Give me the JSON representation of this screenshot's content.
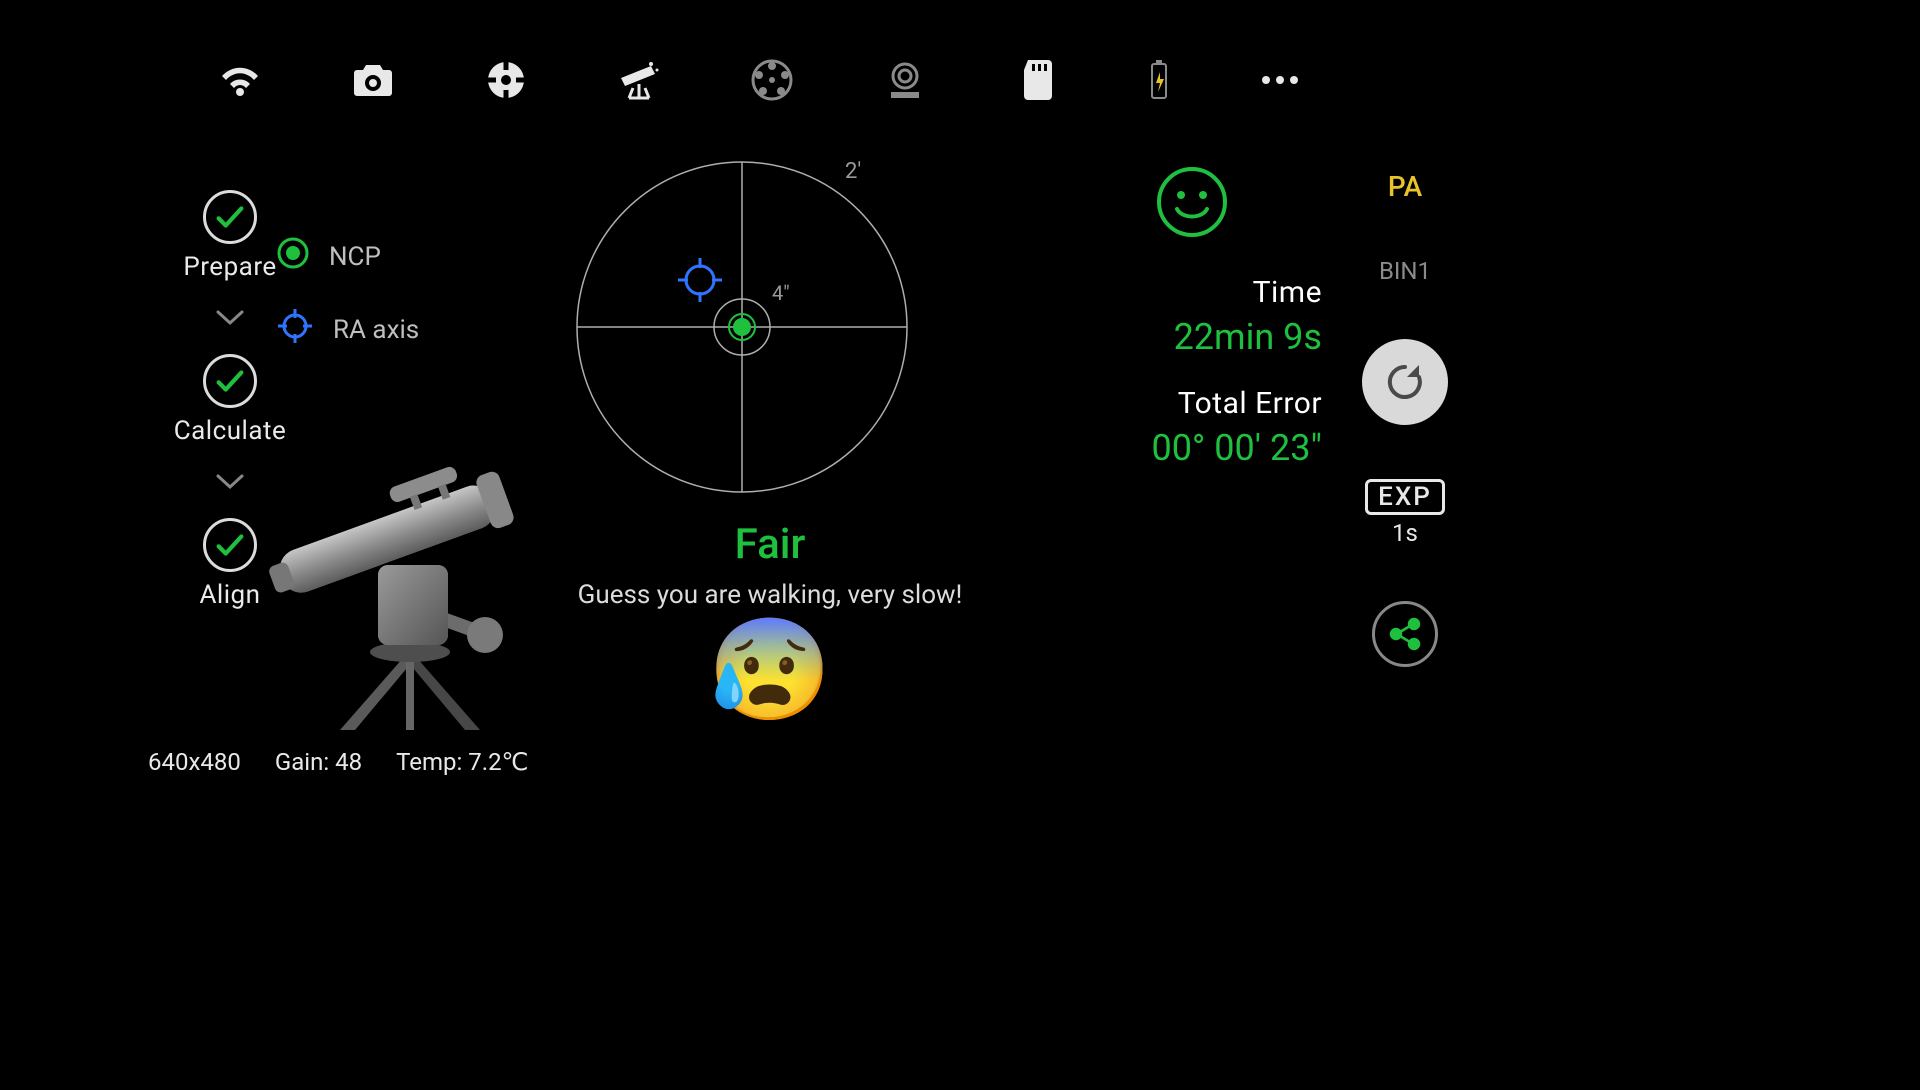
{
  "topbar": {
    "icons": [
      "wifi-icon",
      "camera-icon",
      "target-icon",
      "telescope-icon",
      "filterwheel-icon",
      "focuser-icon",
      "sdcard-icon",
      "battery-icon",
      "more-icon"
    ]
  },
  "steps": {
    "items": [
      {
        "label": "Prepare"
      },
      {
        "label": "Calculate"
      },
      {
        "label": "Align"
      }
    ]
  },
  "legend": {
    "ncp": "NCP",
    "ra": "RA axis"
  },
  "target": {
    "outer_label": "2'",
    "inner_label": "4\""
  },
  "rating": {
    "title": "Fair",
    "subtitle": "Guess you are walking, very slow!"
  },
  "right": {
    "time_label": "Time",
    "time_value": "22min 9s",
    "error_label": "Total Error",
    "error_value": "00° 00' 23\""
  },
  "side": {
    "pa": "PA",
    "bin": "BIN1",
    "exp_label": "EXP",
    "exp_value": "1s"
  },
  "bottom": {
    "resolution": "640x480",
    "gain": "Gain: 48",
    "temp": "Temp: 7.2℃"
  }
}
